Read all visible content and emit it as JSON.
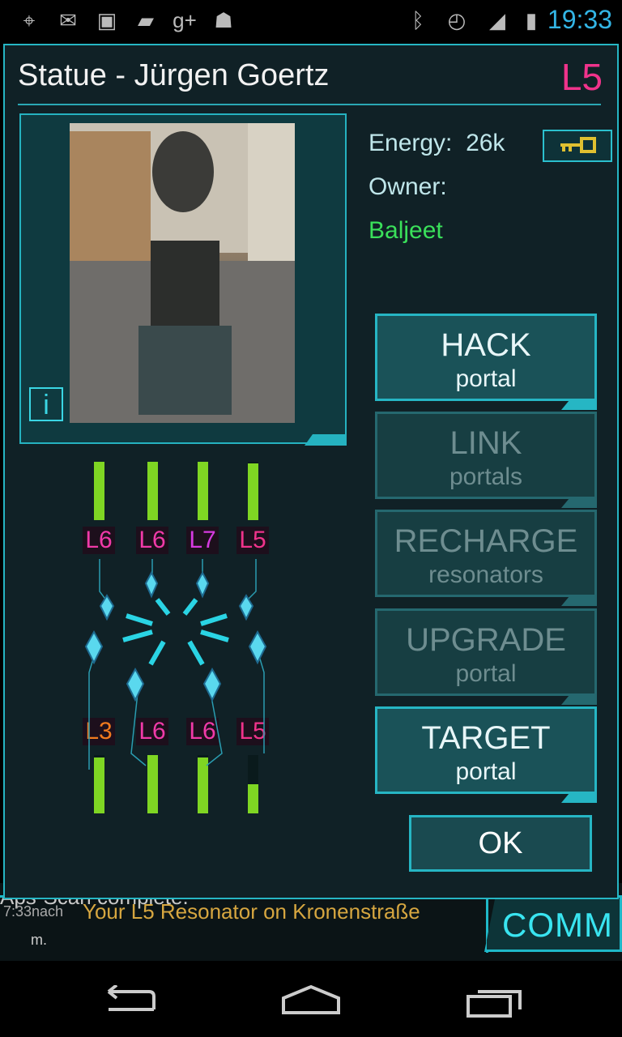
{
  "statusbar": {
    "time": "19:33",
    "icons": [
      "gps-icon",
      "gmail-icon",
      "gallery-icon",
      "talk-icon",
      "gplus-icon",
      "android-icon",
      "bluetooth-icon",
      "alarm-icon",
      "signal-icon",
      "battery-icon"
    ]
  },
  "portal": {
    "title": "Statue - Jürgen Goertz",
    "level": "L5",
    "energy_label": "Energy:",
    "energy_value": "26k",
    "owner_label": "Owner:",
    "owner_name": "Baljeet",
    "info_label": "i"
  },
  "actions": [
    {
      "main": "HACK",
      "sub": "portal",
      "enabled": true
    },
    {
      "main": "LINK",
      "sub": "portals",
      "enabled": false
    },
    {
      "main": "RECHARGE",
      "sub": "resonators",
      "enabled": false
    },
    {
      "main": "UPGRADE",
      "sub": "portal",
      "enabled": false
    },
    {
      "main": "TARGET",
      "sub": "portal",
      "enabled": true
    }
  ],
  "ok_label": "OK",
  "resonators_top": [
    {
      "label": "L6",
      "fill": 1.0,
      "color": "#f03aa8"
    },
    {
      "label": "L6",
      "fill": 1.0,
      "color": "#f03aa8"
    },
    {
      "label": "L7",
      "fill": 1.0,
      "color": "#d63ae0"
    },
    {
      "label": "L5",
      "fill": 0.97,
      "color": "#f0338b"
    }
  ],
  "resonators_bottom": [
    {
      "label": "L3",
      "fill": 0.96,
      "color": "#f07a1e"
    },
    {
      "label": "L6",
      "fill": 1.0,
      "color": "#f03aa8"
    },
    {
      "label": "L6",
      "fill": 0.96,
      "color": "#f03aa8"
    },
    {
      "label": "L5",
      "fill": 0.5,
      "color": "#f0338b"
    }
  ],
  "comm": {
    "label": "COMM",
    "line1": "Aps-Scan complete.",
    "line2": "Your L5 Resonator on Kronenstraße",
    "time": "7:33nach",
    "tail": "m."
  },
  "colors": {
    "accent": "#26b6c4",
    "enemy_green": "#3ae05a",
    "bar_green": "#7fd623"
  }
}
